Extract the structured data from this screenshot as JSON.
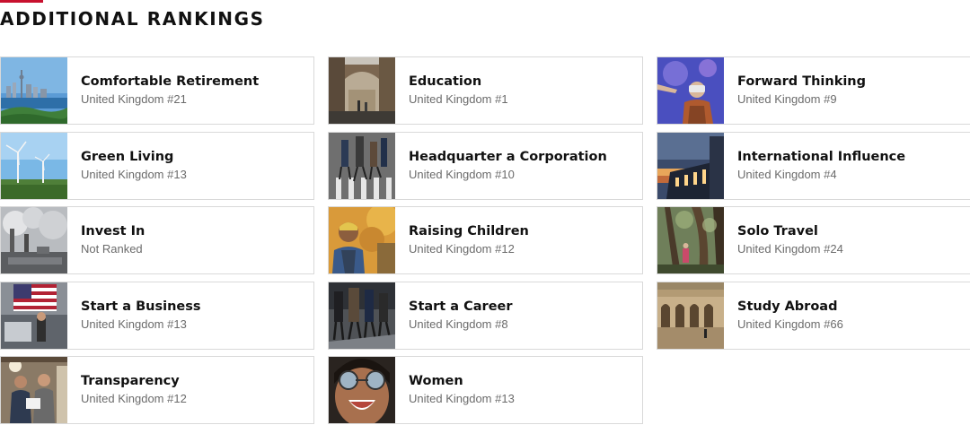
{
  "header": {
    "title": "ADDITIONAL RANKINGS",
    "accent_color": "#c8102e"
  },
  "rankings": [
    {
      "title": "Comfortable Retirement",
      "subtitle": "United Kingdom #21",
      "image": "city-harbor-skyline"
    },
    {
      "title": "Education",
      "subtitle": "United Kingdom #1",
      "image": "stone-bridge-archway"
    },
    {
      "title": "Forward Thinking",
      "subtitle": "United Kingdom #9",
      "image": "vr-headset-person"
    },
    {
      "title": "Green Living",
      "subtitle": "United Kingdom #13",
      "image": "wind-turbines-field"
    },
    {
      "title": "Headquarter a Corporation",
      "subtitle": "United Kingdom #10",
      "image": "pedestrian-crosswalk"
    },
    {
      "title": "International Influence",
      "subtitle": "United Kingdom #4",
      "image": "modern-building-dusk"
    },
    {
      "title": "Invest In",
      "subtitle": "Not Ranked",
      "image": "industrial-smokestacks"
    },
    {
      "title": "Raising Children",
      "subtitle": "United Kingdom #12",
      "image": "child-autumn-trees"
    },
    {
      "title": "Solo Travel",
      "subtitle": "United Kingdom #24",
      "image": "forest-traveler"
    },
    {
      "title": "Start a Business",
      "subtitle": "United Kingdom #13",
      "image": "american-flag-shop"
    },
    {
      "title": "Start a Career",
      "subtitle": "United Kingdom #8",
      "image": "commuters-walking"
    },
    {
      "title": "Study Abroad",
      "subtitle": "United Kingdom #66",
      "image": "university-colonnade"
    },
    {
      "title": "Transparency",
      "subtitle": "United Kingdom #12",
      "image": "people-reading-document"
    },
    {
      "title": "Women",
      "subtitle": "United Kingdom #13",
      "image": "woman-mirrored-sunglasses"
    }
  ]
}
